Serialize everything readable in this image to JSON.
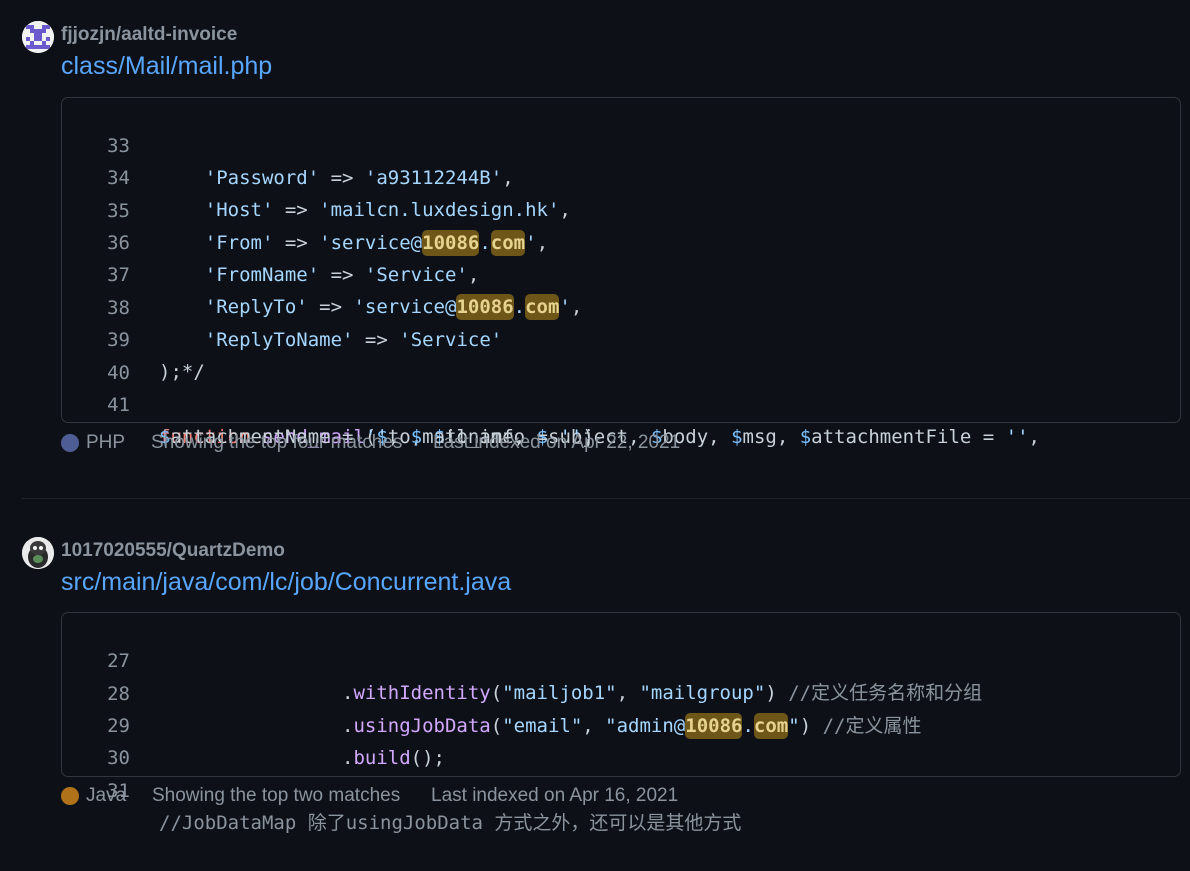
{
  "results": [
    {
      "owner": "fjjozjn",
      "repo": "aaltd-invoice",
      "file_path": "class/Mail/mail.php",
      "lines": [
        {
          "n": "33",
          "text": "    'Password' => 'a93112244B',"
        },
        {
          "n": "34",
          "text": "    'Host' => 'mailcn.luxdesign.hk',"
        },
        {
          "n": "35",
          "text": "    'From' => 'service@10086.com',"
        },
        {
          "n": "36",
          "text": "    'FromName' => 'Service',"
        },
        {
          "n": "37",
          "text": "    'ReplyTo' => 'service@10086.com',"
        },
        {
          "n": "38",
          "text": "    'ReplyToName' => 'Service'"
        },
        {
          "n": "39",
          "text": ");*/"
        },
        {
          "n": "40",
          "text": ""
        },
        {
          "n": "41",
          "text": "function send_mail($to, $toname, $subject, $body, $msg, $attachmentFile = '', $attachmentName = '', $mail_info = '')"
        }
      ],
      "language": "PHP",
      "language_color": "#4F5D95",
      "matches": "Showing the top four matches",
      "indexed": "Last indexed on Apr 22, 2021"
    },
    {
      "owner": "1017020555",
      "repo": "QuartzDemo",
      "file_path": "src/main/java/com/lc/job/Concurrent.java",
      "lines": [
        {
          "n": "27",
          "text": "                .withIdentity(\"mailjob1\", \"mailgroup\") //定义任务名称和分组"
        },
        {
          "n": "28",
          "text": "                .usingJobData(\"email\", \"admin@10086.com\") //定义属性"
        },
        {
          "n": "29",
          "text": "                .build();"
        },
        {
          "n": "30",
          "text": ""
        },
        {
          "n": "31",
          "text": "//JobDataMap 除了usingJobData 方式之外，还可以是其他方式"
        }
      ],
      "language": "Java",
      "language_color": "#b07219",
      "matches": "Showing the top two matches",
      "indexed": "Last indexed on Apr 16, 2021"
    }
  ],
  "highlight_term": [
    "10086",
    "com"
  ]
}
